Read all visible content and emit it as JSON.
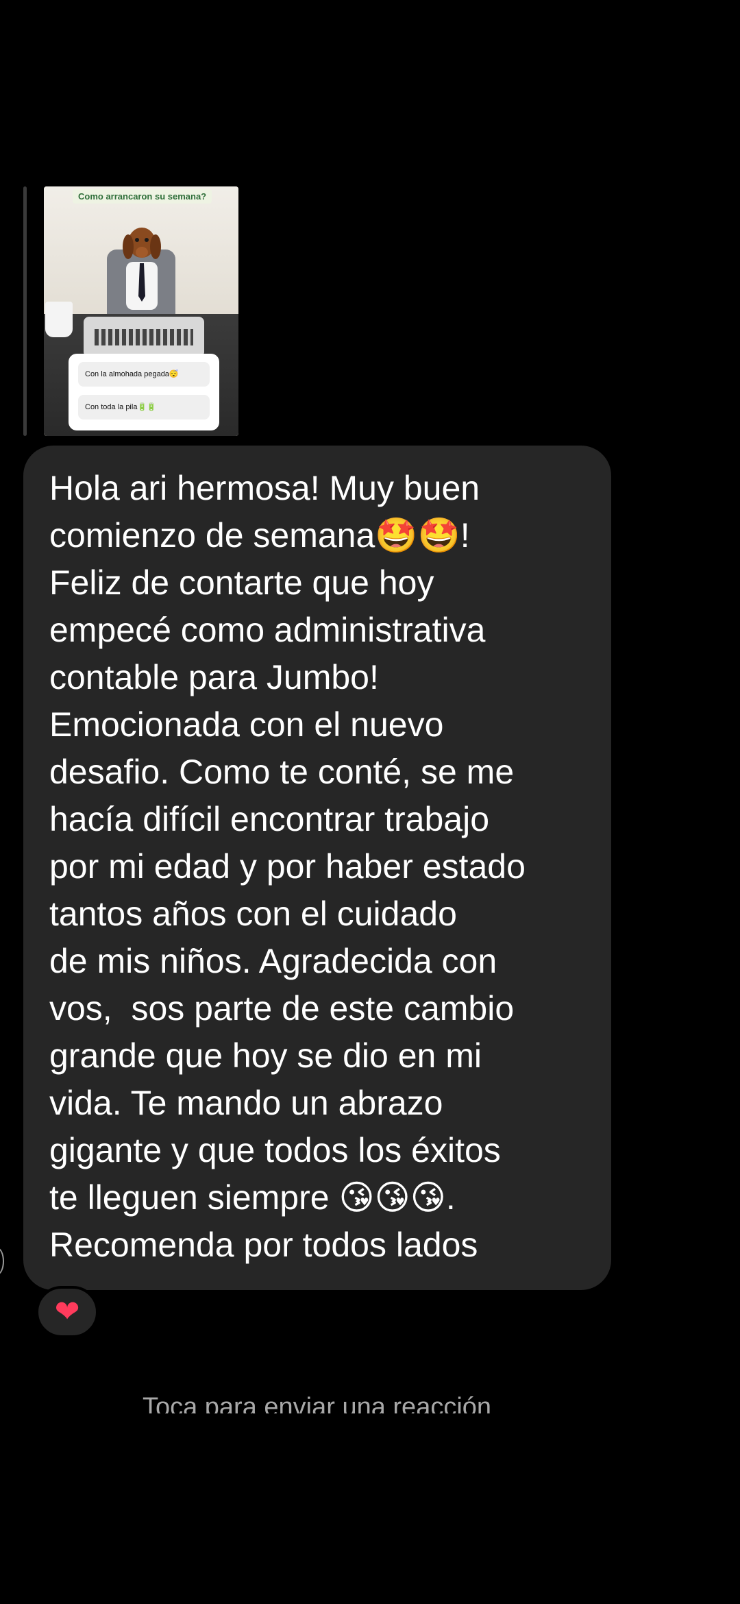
{
  "story_reply": {
    "story_title": "Como arrancaron su semana?",
    "poll_options": [
      "Con la almohada pegada😴",
      "Con toda la pila🔋🔋"
    ]
  },
  "message": {
    "text": "Hola ari hermosa! Muy buen\ncomienzo de semana🤩🤩!\nFeliz de contarte que hoy\nempecé como administrativa\ncontable para Jumbo!\nEmocionada con el nuevo\ndesafio. Como te conté, se me\nhacía difícil encontrar trabajo\npor mi edad y por haber estado\ntantos años con el cuidado\nde mis niños. Agradecida con\nvos,  sos parte de este cambio\ngrande que hoy se dio en mi\nvida. Te mando un abrazo\ngigante y que todos los éxitos\nte lleguen siempre 😘😘😘.\nRecomenda por todos lados",
    "reaction": "❤",
    "reaction_icon": "heart-icon"
  },
  "footer": {
    "tap_hint": "Toca para enviar una reacción"
  },
  "colors": {
    "background": "#000000",
    "bubble": "#262626",
    "text": "#ffffff",
    "hint": "#a8a8a8",
    "heart": "#ff3b5c"
  }
}
